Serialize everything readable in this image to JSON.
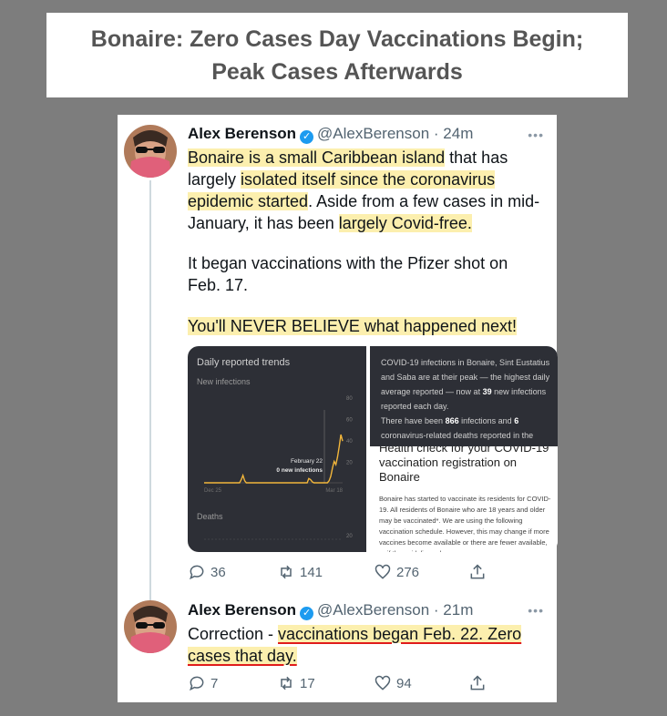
{
  "banner": {
    "title": "Bonaire: Zero Cases Day Vaccinations Begin;\nPeak Cases Afterwards"
  },
  "tweet1": {
    "name": "Alex Berenson",
    "handle": "@AlexBerenson",
    "dot": "·",
    "time": "24m",
    "more": "•••",
    "text": {
      "s1": "Bonaire is a small Caribbean island",
      "s2": " that has largely ",
      "s3": "isolated itself since the coronavirus epidemic started",
      "s4": ". Aside from a few cases in mid-January, it has been ",
      "s5": "largely Covid-free.",
      "p2": "It began vaccinations with the Pfizer shot on Feb. 17.",
      "p3": "You'll NEVER BELIEVE what happened next!"
    },
    "media": {
      "chart_title": "Daily reported trends",
      "chart_subtitle": "New infections",
      "annotation_date": "February 22",
      "annotation_value": "0 new infections",
      "x_start": "Dec 25",
      "x_end": "Mar 18",
      "y_ticks": [
        "80",
        "60",
        "40",
        "20"
      ],
      "deaths_label": "Deaths",
      "deaths_tick": "20",
      "info_p1": "COVID-19 infections in Bonaire, Sint Eustatius and Saba are at their peak — the highest daily average reported — now at",
      "info_p1_num": "39",
      "info_p1_end": "new infections reported each day.",
      "info_p2a": "There have been",
      "info_p2_num1": "866",
      "info_p2b": "infections and",
      "info_p2_num2": "6",
      "info_p2c": "coronavirus-related deaths reported in the",
      "card_title": "Health check for your COVID-19 vaccination registration on Bonaire",
      "card_body": "Bonaire has started to vaccinate its residents for COVID-19. All residents of Bonaire who are 18 years and older may be vaccinated*. We are using the following vaccination schedule. However, this may change if more vaccines become available or there are fewer available, or if the guidelines change."
    },
    "actions": {
      "replies": "36",
      "retweets": "141",
      "likes": "276"
    }
  },
  "tweet2": {
    "name": "Alex Berenson",
    "handle": "@AlexBerenson",
    "dot": "·",
    "time": "21m",
    "more": "•••",
    "text": {
      "s1": "Correction - ",
      "s2": "vaccinations began Feb. 22. Zero cases that day."
    },
    "actions": {
      "replies": "7",
      "retweets": "17",
      "likes": "94"
    }
  },
  "colors": {
    "highlight": "#fcefae",
    "underline": "#e01c1c",
    "verified": "#1d9bf0",
    "chart_line": "#f2b63b"
  },
  "chart_data": {
    "type": "line",
    "title": "Daily reported trends",
    "subtitle": "New infections",
    "x_start": "Dec 25",
    "x_end": "Mar 18",
    "series": [
      {
        "name": "New infections",
        "values": [
          0,
          0,
          0,
          0,
          0,
          0,
          0,
          0,
          0,
          0,
          0,
          0,
          0,
          0,
          0,
          0,
          0,
          0,
          0,
          0,
          0,
          0,
          3,
          7,
          2,
          0,
          0,
          0,
          0,
          0,
          0,
          0,
          0,
          0,
          0,
          0,
          0,
          0,
          0,
          0,
          0,
          0,
          0,
          0,
          0,
          0,
          0,
          0,
          0,
          0,
          0,
          0,
          0,
          0,
          0,
          0,
          0,
          0,
          0,
          0,
          0,
          0,
          4,
          3,
          1,
          0,
          0,
          0,
          0,
          0,
          0,
          0,
          0,
          0,
          2,
          6,
          14,
          20,
          17,
          24,
          34,
          45,
          39
        ]
      }
    ],
    "ylim": [
      0,
      80
    ],
    "y_ticks": [
      20,
      40,
      60,
      80
    ],
    "annotation": {
      "label": "February 22",
      "value": "0 new infections"
    }
  }
}
